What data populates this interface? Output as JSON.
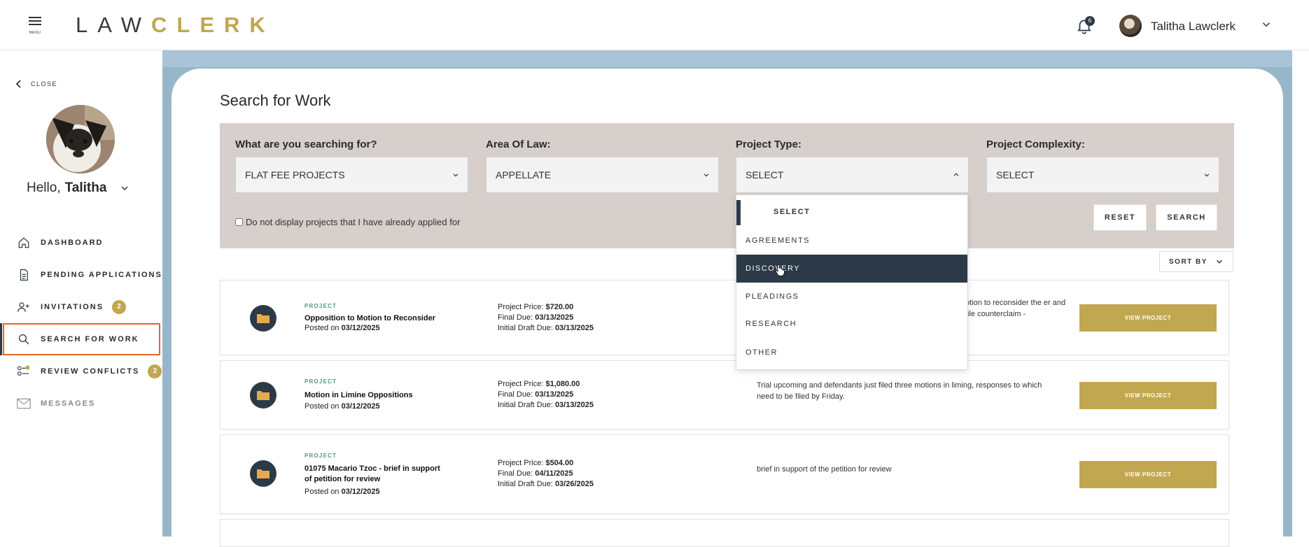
{
  "header": {
    "menu_label": "MENU",
    "logo_part1": "LAW",
    "logo_part2": "CLERK",
    "notification_count": "6",
    "user_name": "Talitha Lawclerk"
  },
  "sidebar": {
    "close_label": "CLOSE",
    "hello_prefix": "Hello,",
    "hello_name": "Talitha",
    "items": [
      {
        "label": "DASHBOARD",
        "icon": "home-icon"
      },
      {
        "label": "PENDING APPLICATIONS",
        "icon": "document-icon"
      },
      {
        "label": "INVITATIONS",
        "icon": "add-user-icon",
        "count": "2"
      },
      {
        "label": "SEARCH FOR WORK",
        "icon": "search-icon",
        "active": true
      },
      {
        "label": "REVIEW CONFLICTS",
        "icon": "conflicts-icon",
        "count": "2"
      },
      {
        "label": "MESSAGES",
        "icon": "mail-icon"
      }
    ]
  },
  "main": {
    "title": "Search for Work",
    "filters": {
      "searching_for_label": "What are you searching for?",
      "searching_for_value": "FLAT FEE PROJECTS",
      "area_label": "Area Of Law:",
      "area_value": "APPELLATE",
      "type_label": "Project Type:",
      "type_value": "SELECT",
      "complexity_label": "Project Complexity:",
      "complexity_value": "SELECT",
      "checkbox_label": "Do not display projects that I have already applied for",
      "reset_label": "RESET",
      "search_label": "SEARCH"
    },
    "sort_label": "SORT BY",
    "dropdown_options": [
      "SELECT",
      "AGREEMENTS",
      "DISCOVERY",
      "PLEADINGS",
      "RESEARCH",
      "OTHER"
    ],
    "dropdown_highlighted": "DISCOVERY",
    "projects": [
      {
        "tag": "PROJECT",
        "title": "Opposition to Motion to Reconsider",
        "posted_prefix": "Posted on",
        "posted_date": "03/12/2025",
        "price_label": "Project Price:",
        "price": "$720.00",
        "final_label": "Final Due:",
        "final_due": "03/13/2025",
        "draft_label": "Initial Draft Due:",
        "draft_due": "03/13/2025",
        "description": "otion to reconsider the er and file counterclaim -",
        "button": "VIEW PROJECT"
      },
      {
        "tag": "PROJECT",
        "title": "Motion in Limine Oppositions",
        "posted_prefix": "Posted on",
        "posted_date": "03/12/2025",
        "price_label": "Project Price:",
        "price": "$1,080.00",
        "final_label": "Final Due:",
        "final_due": "03/13/2025",
        "draft_label": "Initial Draft Due:",
        "draft_due": "03/13/2025",
        "description": "Trial upcoming and defendants just filed three motions in liming, responses to which need to be filed by Friday.",
        "button": "VIEW PROJECT"
      },
      {
        "tag": "PROJECT",
        "title": "01075 Macario Tzoc - brief in support of petition for review",
        "posted_prefix": "Posted on",
        "posted_date": "03/12/2025",
        "price_label": "Project Price:",
        "price": "$504.00",
        "final_label": "Final Due:",
        "final_due": "04/11/2025",
        "draft_label": "Initial Draft Due:",
        "draft_due": "03/26/2025",
        "description": "brief in support of the petition for review",
        "button": "VIEW PROJECT"
      }
    ]
  },
  "colors": {
    "brand_gold": "#c1a74f",
    "navy": "#2c3a47",
    "active_outline": "#e86624",
    "filter_bg": "#d6cfcb",
    "page_bg": "#98b6c9"
  }
}
